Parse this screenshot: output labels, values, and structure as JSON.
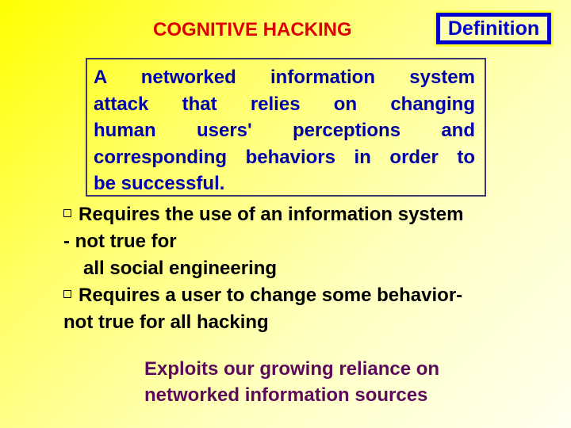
{
  "slide": {
    "title": "COGNITIVE HACKING",
    "tag_label": "Definition",
    "definition": {
      "lines": [
        "A networked information system",
        "attack that relies on changing",
        "human users' perceptions and",
        "corresponding behaviors in order to",
        "be successful."
      ]
    },
    "bullets": [
      {
        "marker_icon": "hollow-square-bullet",
        "lines": [
          "Requires the use of an information system",
          "- not true for",
          "all social  engineering"
        ]
      },
      {
        "marker_icon": "hollow-square-bullet",
        "lines": [
          "Requires a user to change some behavior-",
          "not true for all hacking"
        ]
      }
    ],
    "footer_note": {
      "lines": [
        "Exploits our growing reliance on",
        "networked information sources"
      ]
    }
  },
  "colors": {
    "title": "#dd0000",
    "tag_text": "#0000cc",
    "tag_border": "#0000cc",
    "definition_text": "#0000aa",
    "definition_border": "#3a3a6a",
    "bullet_text": "#000000",
    "footer_text": "#5c0a5c",
    "background_start": "#ffff00",
    "background_end": "#fffff0"
  }
}
